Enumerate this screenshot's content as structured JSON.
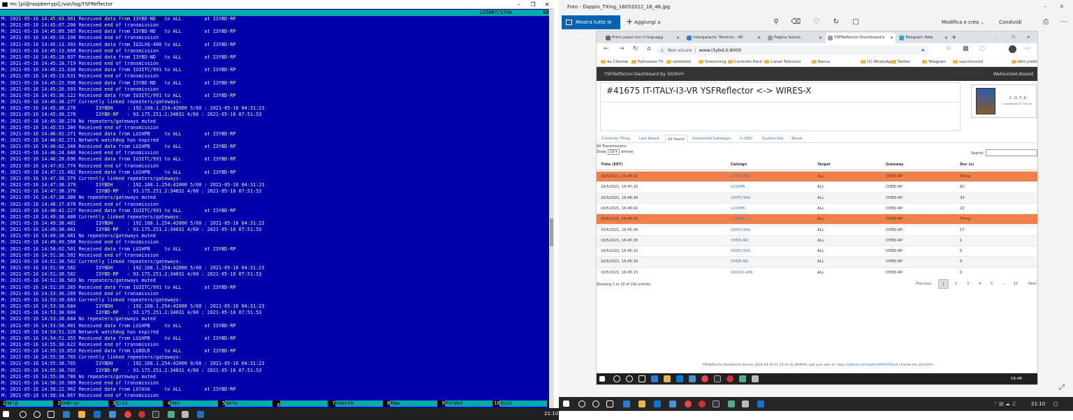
{
  "terminal": {
    "title": "mc [pi@raspberrypi]:/var/log/YSFReflector",
    "path": "/var/log/YSFReflector/YSFReflector-2021-05-16.log",
    "position": "125087/176K",
    "percent": "68%",
    "lines": [
      "M: 2021-05-16 14:45:03.901 Received data from I3YBD-ND   to ALL        at I3YBD-RP",
      "M: 2021-05-16 14:45:07.200 Received end of transmission",
      "M: 2021-05-16 14:45:09.585 Received data from I3YBD-ND   to ALL        at I3YBD-RP",
      "M: 2021-05-16 14:45:10.198 Received end of transmission",
      "M: 2021-05-16 14:45:13.393 Received data from IU2LXQ-400 to ALL        at I3YBD-RP",
      "M: 2021-05-16 14:45:13.660 Received end of transmission",
      "M: 2021-05-16 14:45:18.037 Received data from I3YBD-ND   to ALL        at I3YBD-RP",
      "M: 2021-05-16 14:45:18.719 Received end of transmission",
      "M: 2021-05-16 14:45:23.330 Received data from IU3ITC/991 to ALL        at I3YBD-RP",
      "M: 2021-05-16 14:45:23.631 Received end of transmission",
      "M: 2021-05-16 14:45:25.996 Received data from I3YBD-ND   to ALL        at I3YBD-RP",
      "M: 2021-05-16 14:45:26.593 Received end of transmission",
      "M: 2021-05-16 14:45:36.122 Received data from IU3ITC/991 to ALL        at I3YBD-RP",
      "M: 2021-05-16 14:45:38.277 Currently linked repeaters/gateways:",
      "M: 2021-05-16 14:45:38.278       I3YBDH     : 192.168.1.254:42000 5/60 : 2021-05-16 04:31:23",
      "M: 2021-05-16 14:45:38.278       I3YBD-RP   : 93.175.251.2:34031 4/60 : 2021-05-16 07:51:53",
      "M: 2021-05-16 14:45:38.278 No repeaters/gateways muted",
      "M: 2021-05-16 14:45:53.209 Received end of transmission",
      "M: 2021-05-16 14:46:02.271 Received data from LU1HPB     to ALL        at I3YBD-RP",
      "M: 2021-05-16 14:46:02.271 Network watchdog has expired",
      "M: 2021-05-16 14:46:02.348 Received data from LU1HPB     to ALL        at I3YBD-RP",
      "M: 2021-05-16 14:46:24.848 Received end of transmission",
      "M: 2021-05-16 14:46:28.696 Received data from IU3ITC/991 to ALL        at I3YBD-RP",
      "M: 2021-05-16 14:47:01.774 Received end of transmission",
      "M: 2021-05-16 14:47:15.482 Received data from LU1HPB     to ALL        at I3YBD-RP",
      "M: 2021-05-16 14:47:38.379 Currently linked repeaters/gateways:",
      "M: 2021-05-16 14:47:38.379       I3YBDH     : 192.168.1.254:42000 5/60 : 2021-05-16 04:31:23",
      "M: 2021-05-16 14:47:38.379       I3YBD-RP   : 93.175.251.2:34031 4/60 : 2021-05-16 07:51:53",
      "M: 2021-05-16 14:47:38.380 No repeaters/gateways muted",
      "M: 2021-05-16 14:48:37.678 Received end of transmission",
      "M: 2021-05-16 14:48:42.227 Received data from IU3ITC/991 to ALL        at I3YBD-RP",
      "M: 2021-05-16 14:49:38.480 Currently linked repeaters/gateways:",
      "M: 2021-05-16 14:49:38.481       I3YBDH     : 192.168.1.254:42000 5/60 : 2021-05-16 04:31:23",
      "M: 2021-05-16 14:49:38.481       I3YBD-RP   : 93.175.251.2:34031 4/60 : 2021-05-16 07:51:53",
      "M: 2021-05-16 14:49:38.481 No repeaters/gateways muted",
      "M: 2021-05-16 14:49:49.560 Received end of transmission",
      "M: 2021-05-16 14:50:02.501 Received data from LU1HPB     to ALL        at I3YBD-RP",
      "M: 2021-05-16 14:51:36.502 Received end of transmission",
      "M: 2021-05-16 14:51:38.582 Currently linked repeaters/gateways:",
      "M: 2021-05-16 14:51:38.582       I3YBDH     : 192.168.1.254:42000 5/60 : 2021-05-16 04:31:23",
      "M: 2021-05-16 14:51:38.582       I3YBD-RP   : 93.175.251.2:34031 4/60 : 2021-05-16 07:51:53",
      "M: 2021-05-16 14:51:38.583 No repeaters/gateways muted",
      "M: 2021-05-16 14:51:39.285 Received data from IU3ITC/991 to ALL        at I3YBD-RP",
      "M: 2021-05-16 14:53:36.289 Received end of transmission",
      "M: 2021-05-16 14:53:38.683 Currently linked repeaters/gateways:",
      "M: 2021-05-16 14:53:38.684       I3YBDH     : 192.168.1.254:42000 5/60 : 2021-05-16 04:31:23",
      "M: 2021-05-16 14:53:38.684       I3YBD-RP   : 93.175.251.2:34031 4/60 : 2021-05-16 07:51:53",
      "M: 2021-05-16 14:53:38.684 No repeaters/gateways muted",
      "M: 2021-05-16 14:53:50.401 Received data from LU1HPB     to ALL        at I3YBD-RP",
      "M: 2021-05-16 14:54:51.328 Network watchdog has expired",
      "M: 2021-05-16 14:54:51.355 Received data from LU1HPB     to ALL        at I3YBD-RP",
      "M: 2021-05-16 14:55:30.622 Received end of transmission",
      "M: 2021-05-16 14:55:33.053 Received data from LU8DLR     to ALL        at I3YBD-RP",
      "M: 2021-05-16 14:55:38.785 Currently linked repeaters/gateways:",
      "M: 2021-05-16 14:55:38.785       I3YBDH     : 192.168.1.254:42000 0/60 : 2021-05-16 04:31:23",
      "M: 2021-05-16 14:55:38.785       I3YBD-RP   : 93.175.251.2:34031 4/60 : 2021-05-16 07:51:53",
      "M: 2021-05-16 14:55:38.786 No repeaters/gateways muted",
      "M: 2021-05-16 14:56:10.989 Received end of transmission",
      "M: 2021-05-16 14:56:22.962 Received data from LU7AVA     to ALL        at I3YBD-RP",
      "M: 2021-05-16 14:56:34.667 Received end of transmission"
    ],
    "fkeys": [
      {
        "num": "1",
        "label": "Help"
      },
      {
        "num": "2",
        "label": "UnWrap"
      },
      {
        "num": "3",
        "label": "Quit"
      },
      {
        "num": "4",
        "label": "Hex"
      },
      {
        "num": "5",
        "label": "Goto"
      },
      {
        "num": "6",
        "label": ""
      },
      {
        "num": "7",
        "label": "Search"
      },
      {
        "num": "8",
        "label": "Raw"
      },
      {
        "num": "9",
        "label": "Format"
      },
      {
        "num": "10",
        "label": "Quit"
      }
    ],
    "clock": "21:10"
  },
  "photos": {
    "title": "Foto - Doppio_TXing_16052012_16_46.jpg",
    "btn_all": "Mostra tutte le foto",
    "btn_add": "Aggiungi a",
    "btn_edit": "Modifica e crea",
    "btn_share": "Condividi",
    "clock": "21:10"
  },
  "browser": {
    "tabs": [
      {
        "label": "Primi passi con il linguagg",
        "color": "#666666"
      },
      {
        "label": "Intergalactic Torrents - Wi",
        "color": "#3a7bd5"
      },
      {
        "label": "Pagina Saluto",
        "color": "#9e9e9e"
      },
      {
        "label": "YSFReflector-Dashboard b",
        "color": "#9e9e9e"
      },
      {
        "label": "Telegram Web",
        "color": "#2aa3e0"
      }
    ],
    "not_secure": "Non sicuro",
    "url": "www.i3ybd.it:8000",
    "bookmarks": [
      "da Chrome",
      "Palinsesto TV",
      "sottotitoli",
      "Stremming",
      "Controllo Ponti",
      "Canali Televisivi",
      "Banca",
      "(1) WhatsApp",
      "Twitter",
      "Telegram",
      "vaccinicovid",
      "Altri preferiti"
    ],
    "inner_clock": "16:48"
  },
  "dashboard": {
    "brand": "YSFReflector-Dashboard by DG9VH",
    "mode": "Websocket-Based",
    "reflector_title": "#41675 IT-ITALY-I3-VR YSFReflector <-> WIRES-X",
    "logo_text": "C.O.T.A.",
    "logo_sub": "Confederate On The Air",
    "tabs": [
      "Currently TXing",
      "Last Heard",
      "All Heard",
      "Connected Gateways",
      "In QSO",
      "System Info",
      "About"
    ],
    "active_tab": 2,
    "section_label": "All Transmissions",
    "show_label": "Show",
    "show_value": "10",
    "entries_label": "entries",
    "search_label": "Search:",
    "columns": [
      "Time (EET)",
      "Callsign",
      "Target",
      "Gateway",
      "Dur (s)"
    ],
    "rows": [
      {
        "time": "16/5/2021, 16:48:42",
        "callsign": "IU3ITC/991",
        "target": "ALL",
        "gateway": "I3YBD-RP",
        "dur": "TXing",
        "tx": true
      },
      {
        "time": "16/5/2021, 16:47:15",
        "callsign": "LU1HPB",
        "target": "ALL",
        "gateway": "I3YBD-RP",
        "dur": "82",
        "tx": false
      },
      {
        "time": "16/5/2021, 16:46:28",
        "callsign": "IU3ITC/991",
        "target": "ALL",
        "gateway": "I3YBD-RP",
        "dur": "33",
        "tx": false
      },
      {
        "time": "16/5/2021, 16:46:02",
        "callsign": "LU1HPB",
        "target": "ALL",
        "gateway": "I3YBD-RP",
        "dur": "22",
        "tx": false
      },
      {
        "time": "16/5/2021, 16:46:02",
        "callsign": "LU1HPB",
        "target": "ALL",
        "gateway": "I3YBD-RP",
        "dur": "TXing",
        "tx": true
      },
      {
        "time": "16/5/2021, 16:45:36",
        "callsign": "IU3ITC/991",
        "target": "ALL",
        "gateway": "I3YBD-RP",
        "dur": "17",
        "tx": false
      },
      {
        "time": "16/5/2021, 16:45:25",
        "callsign": "I3YBD-ND",
        "target": "ALL",
        "gateway": "I3YBD-RP",
        "dur": "1",
        "tx": false
      },
      {
        "time": "16/5/2021, 16:45:23",
        "callsign": "IU3ITC/991",
        "target": "ALL",
        "gateway": "I3YBD-RP",
        "dur": "0",
        "tx": false
      },
      {
        "time": "16/5/2021, 16:45:18",
        "callsign": "I3YBD-ND",
        "target": "ALL",
        "gateway": "I3YBD-RP",
        "dur": "0",
        "tx": false
      },
      {
        "time": "16/5/2021, 16:45:13",
        "callsign": "IU2LXQ-400",
        "target": "ALL",
        "gateway": "I3YBD-RP",
        "dur": "0",
        "tx": false
      }
    ],
    "showing": "Showing 1 to 10 of 142 entries",
    "pager": [
      "Previous",
      "1",
      "2",
      "3",
      "4",
      "5",
      "...",
      "15",
      "Next"
    ],
    "current_page": "1",
    "footer_text": "YSFReflector-Dashboard Version 2021-04-10 11:33:31 by DG9VH | get your own at:",
    "footer_link": "https://github.com/dg9vh/WSYSFDash",
    "footer_follow": "| Follow me",
    "footer_handle": "@DG9VH"
  },
  "colors": {
    "terminal_bg": "#0000aa",
    "mc_bar": "#00aaaa",
    "tx_row": "#f0804a",
    "link": "#337ab7",
    "photos_accent": "#0063b1"
  }
}
